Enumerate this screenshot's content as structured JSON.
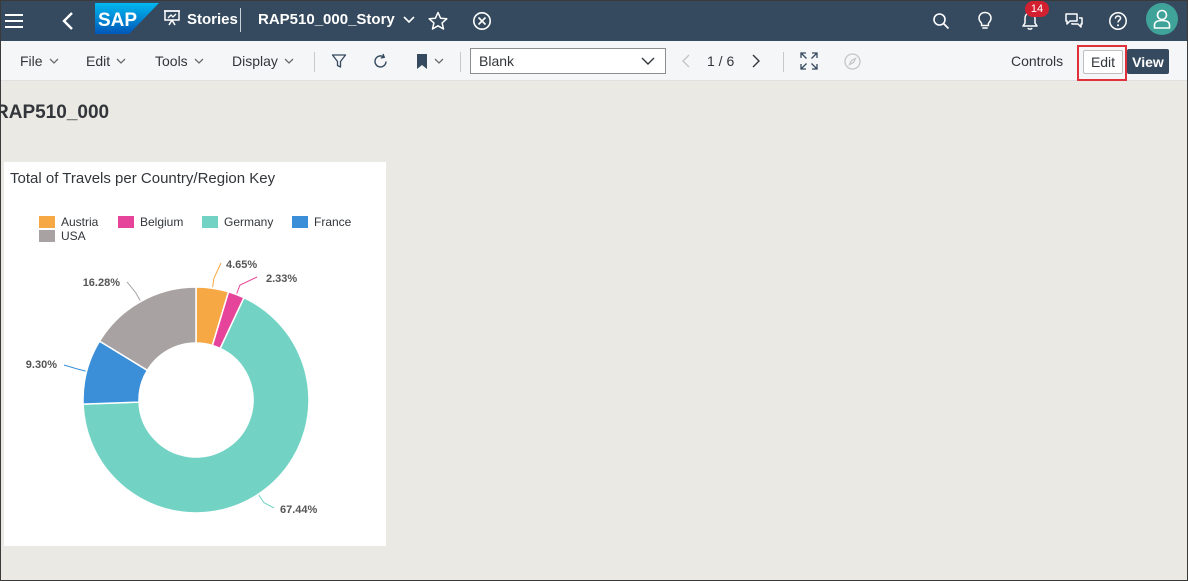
{
  "shell": {
    "stories_label": "Stories",
    "story_title": "RAP510_000_Story",
    "logo_text": "SAP",
    "notification_count": "14"
  },
  "toolbar": {
    "file": "File",
    "edit_menu": "Edit",
    "tools": "Tools",
    "display": "Display",
    "page_select": "Blank",
    "pager": "1 / 6",
    "controls": "Controls",
    "edit_button": "Edit",
    "view_button": "View"
  },
  "page": {
    "heading": "RAP510_000"
  },
  "colors": {
    "shell": "#354a5f",
    "austria": "#f6a845",
    "belgium": "#e6449a",
    "germany": "#72d3c4",
    "france": "#3a8fd8",
    "usa": "#a8a2a2",
    "highlight": "#e0313b"
  },
  "chart_data": {
    "type": "pie",
    "title": "Total of Travels per Country/Region Key",
    "legend_position": "top",
    "categories": [
      "Austria",
      "Belgium",
      "Germany",
      "France",
      "USA"
    ],
    "values": [
      4.65,
      2.33,
      67.44,
      9.3,
      16.28
    ],
    "labels": [
      "4.65%",
      "2.33%",
      "67.44%",
      "9.30%",
      "16.28%"
    ]
  }
}
